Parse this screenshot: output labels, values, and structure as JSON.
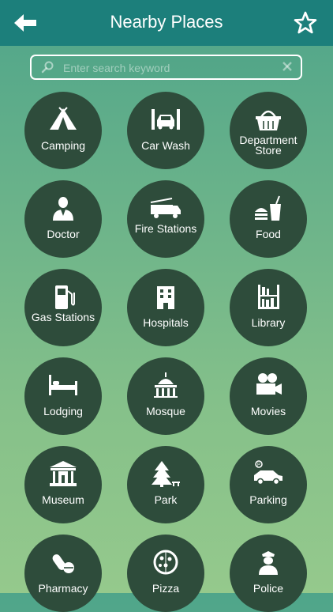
{
  "header": {
    "title": "Nearby Places",
    "back_icon": "back-arrow-icon",
    "favorite_icon": "star-icon"
  },
  "search": {
    "placeholder": "Enter search keyword",
    "value": ""
  },
  "categories": [
    {
      "label": "Camping",
      "icon": "tent-icon"
    },
    {
      "label": "Car Wash",
      "icon": "car-wash-icon"
    },
    {
      "label": "Department Store",
      "icon": "shopping-basket-icon"
    },
    {
      "label": "Doctor",
      "icon": "doctor-icon"
    },
    {
      "label": "Fire Stations",
      "icon": "fire-truck-icon"
    },
    {
      "label": "Food",
      "icon": "burger-drink-icon"
    },
    {
      "label": "Gas Stations",
      "icon": "gas-pump-icon"
    },
    {
      "label": "Hospitals",
      "icon": "hospital-building-icon"
    },
    {
      "label": "Library",
      "icon": "bookshelf-icon"
    },
    {
      "label": "Lodging",
      "icon": "bed-icon"
    },
    {
      "label": "Mosque",
      "icon": "dome-building-icon"
    },
    {
      "label": "Movies",
      "icon": "film-camera-icon"
    },
    {
      "label": "Museum",
      "icon": "museum-icon"
    },
    {
      "label": "Park",
      "icon": "pine-tree-icon"
    },
    {
      "label": "Parking",
      "icon": "parking-car-icon"
    },
    {
      "label": "Pharmacy",
      "icon": "pill-icon"
    },
    {
      "label": "Pizza",
      "icon": "pizza-icon"
    },
    {
      "label": "Police",
      "icon": "police-officer-icon"
    }
  ],
  "colors": {
    "header": "#1c7f7b",
    "tile": "#2e4c3b",
    "text": "#ffffff"
  }
}
